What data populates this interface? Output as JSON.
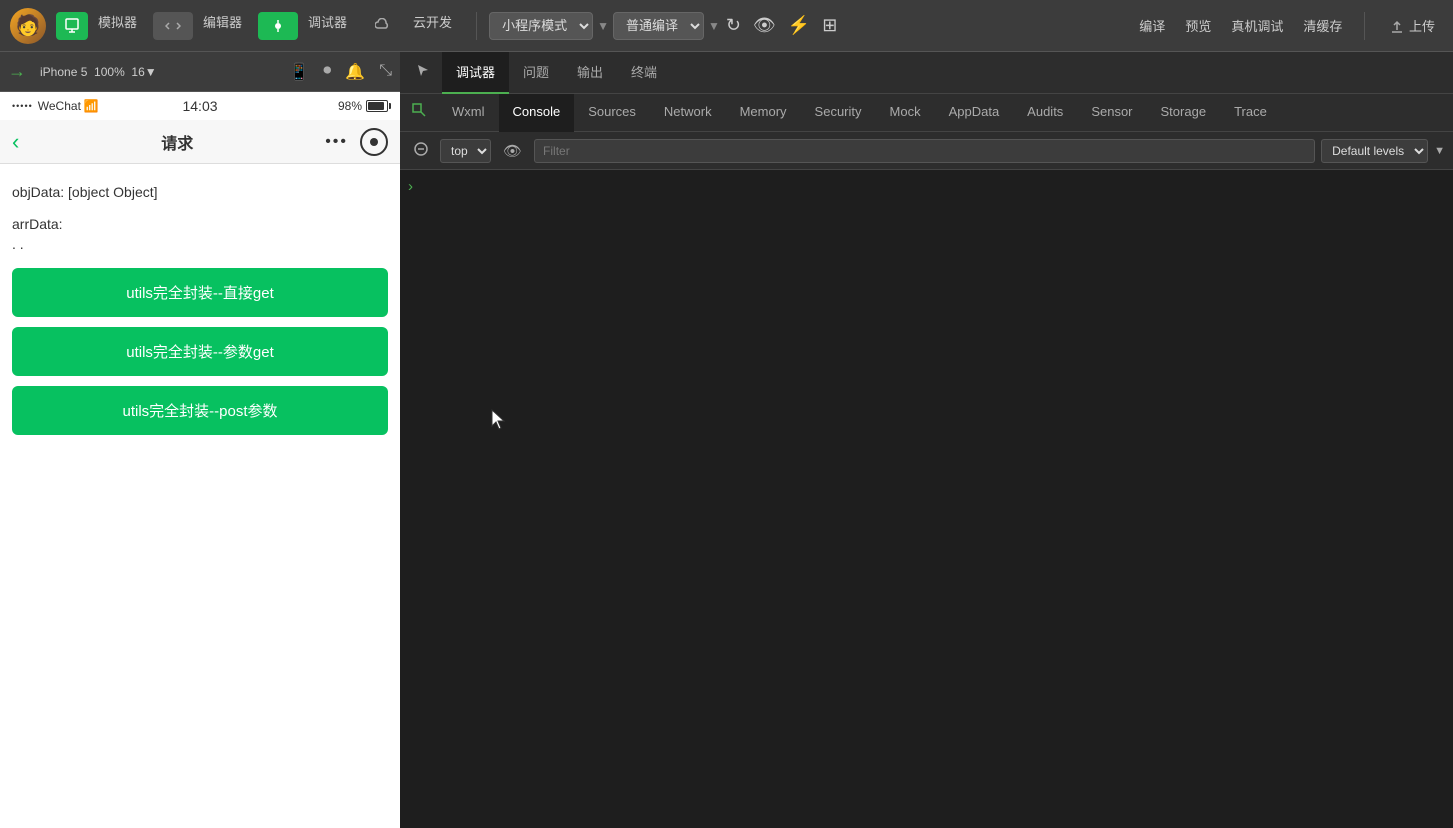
{
  "toolbar": {
    "avatar_label": "avatar",
    "btn_simulator": "模拟器",
    "btn_editor": "编辑器",
    "btn_debug": "调试器",
    "btn_cloud": "云开发",
    "dropdown_mode": "小程序模式",
    "dropdown_compile": "普通编译",
    "btn_compile": "编译",
    "btn_preview": "预览",
    "btn_real_debug": "真机调试",
    "btn_clear": "清缓存",
    "btn_upload": "上传"
  },
  "device": {
    "model": "iPhone 5",
    "zoom": "100%",
    "network": "16"
  },
  "phone": {
    "status_signals": "•••••",
    "status_carrier": "WeChat",
    "status_wifi": "WiFi",
    "status_time": "14:03",
    "status_battery_pct": "98%",
    "nav_title": "请求",
    "nav_back": "‹",
    "content_obj": "objData: [object Object]",
    "content_arr": "arrData:",
    "content_arr2": ". .",
    "btn1": "utils完全封装--直接get",
    "btn2": "utils完全封装--参数get",
    "btn3": "utils完全封装--post参数"
  },
  "devtools": {
    "tabs_top": [
      {
        "label": "调试器",
        "active": true
      },
      {
        "label": "问题",
        "active": false
      },
      {
        "label": "输出",
        "active": false
      },
      {
        "label": "终端",
        "active": false
      }
    ],
    "tabs_main": [
      {
        "label": "Wxml",
        "active": false
      },
      {
        "label": "Console",
        "active": true
      },
      {
        "label": "Sources",
        "active": false
      },
      {
        "label": "Network",
        "active": false
      },
      {
        "label": "Memory",
        "active": false
      },
      {
        "label": "Security",
        "active": false
      },
      {
        "label": "Mock",
        "active": false
      },
      {
        "label": "AppData",
        "active": false
      },
      {
        "label": "Audits",
        "active": false
      },
      {
        "label": "Sensor",
        "active": false
      },
      {
        "label": "Storage",
        "active": false
      },
      {
        "label": "Trace",
        "active": false
      }
    ],
    "toolbar": {
      "context": "top",
      "filter_placeholder": "Filter",
      "levels": "Default levels"
    }
  }
}
